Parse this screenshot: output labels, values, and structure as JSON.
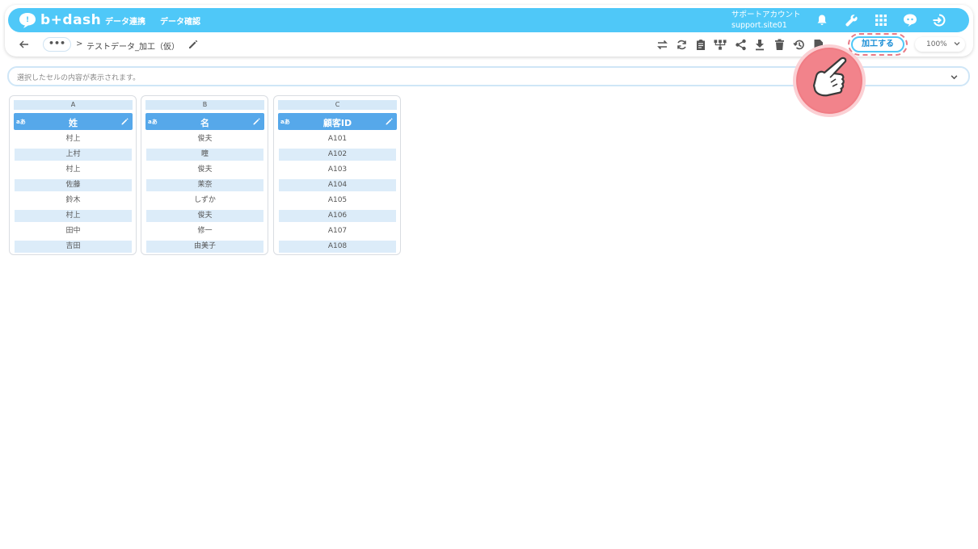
{
  "app": {
    "logo_text": "b+dash",
    "nav": [
      "データ連携",
      "データ確認"
    ],
    "account_name": "サポートアカウント",
    "account_site": "support.site01"
  },
  "toolbar": {
    "dots_label": "•••",
    "breadcrumb_sep": ">",
    "title": "テストデータ_加工（仮）",
    "process_button": "加工する",
    "zoom": "100%"
  },
  "cellbar": {
    "placeholder": "選択したセルの内容が表示されます。"
  },
  "columns": [
    {
      "letter": "A",
      "type": "aあ",
      "name": "姓",
      "values": [
        "村上",
        "上村",
        "村上",
        "佐藤",
        "鈴木",
        "村上",
        "田中",
        "吉田"
      ]
    },
    {
      "letter": "B",
      "type": "aあ",
      "name": "名",
      "values": [
        "俊夫",
        "瞳",
        "俊夫",
        "茉奈",
        "しずか",
        "俊夫",
        "修一",
        "由美子"
      ]
    },
    {
      "letter": "C",
      "type": "aあ",
      "name": "顧客ID",
      "values": [
        "A101",
        "A102",
        "A103",
        "A104",
        "A105",
        "A106",
        "A107",
        "A108"
      ]
    }
  ],
  "colors": {
    "navbar": "#4fc8f8",
    "column_header": "#56a8ea",
    "row_alt": "#dcecf9",
    "highlight": "#f07c84"
  }
}
